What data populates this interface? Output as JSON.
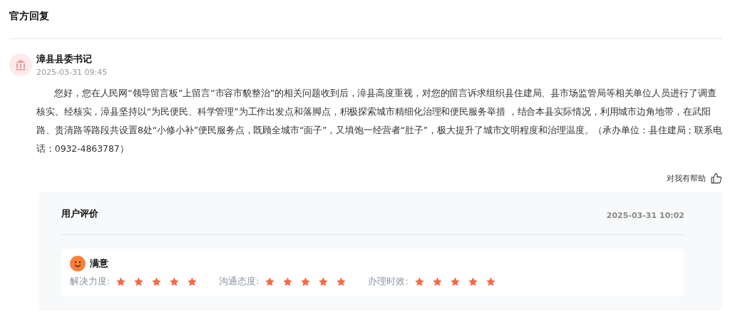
{
  "section_title": "官方回复",
  "reply": {
    "author": "漳县县委书记",
    "time": "2025-03-31 09:45",
    "body": "您好，您在人民网“领导留言板”上留言“市容市貌整治”的相关问题收到后，漳县高度重视，对您的留言诉求组织县住建局、县市场监管局等相关单位人员进行了调查核实。经核实，漳县坚持以“为民便民、科学管理”为工作出发点和落脚点，积极探索城市精细化治理和便民服务举措 ，结合本县实际情况，利用城市边角地带，在武阳路、贵清路等路段共设置8处“小修小补”便民服务点，既顾全城市“面子”，又填饱一经营者“肚子”，极大提升了城市文明程度和治理温度。（承办单位：县住建局；联系电话：0932-4863787）",
    "helpful": "对我有帮助"
  },
  "evaluation": {
    "title": "用户评价",
    "time": "2025-03-31 10:02",
    "verdict": "满意",
    "ratings": [
      {
        "label": "解决力度:",
        "stars": 5
      },
      {
        "label": "沟通态度:",
        "stars": 5
      },
      {
        "label": "办理时效:",
        "stars": 5
      }
    ]
  }
}
